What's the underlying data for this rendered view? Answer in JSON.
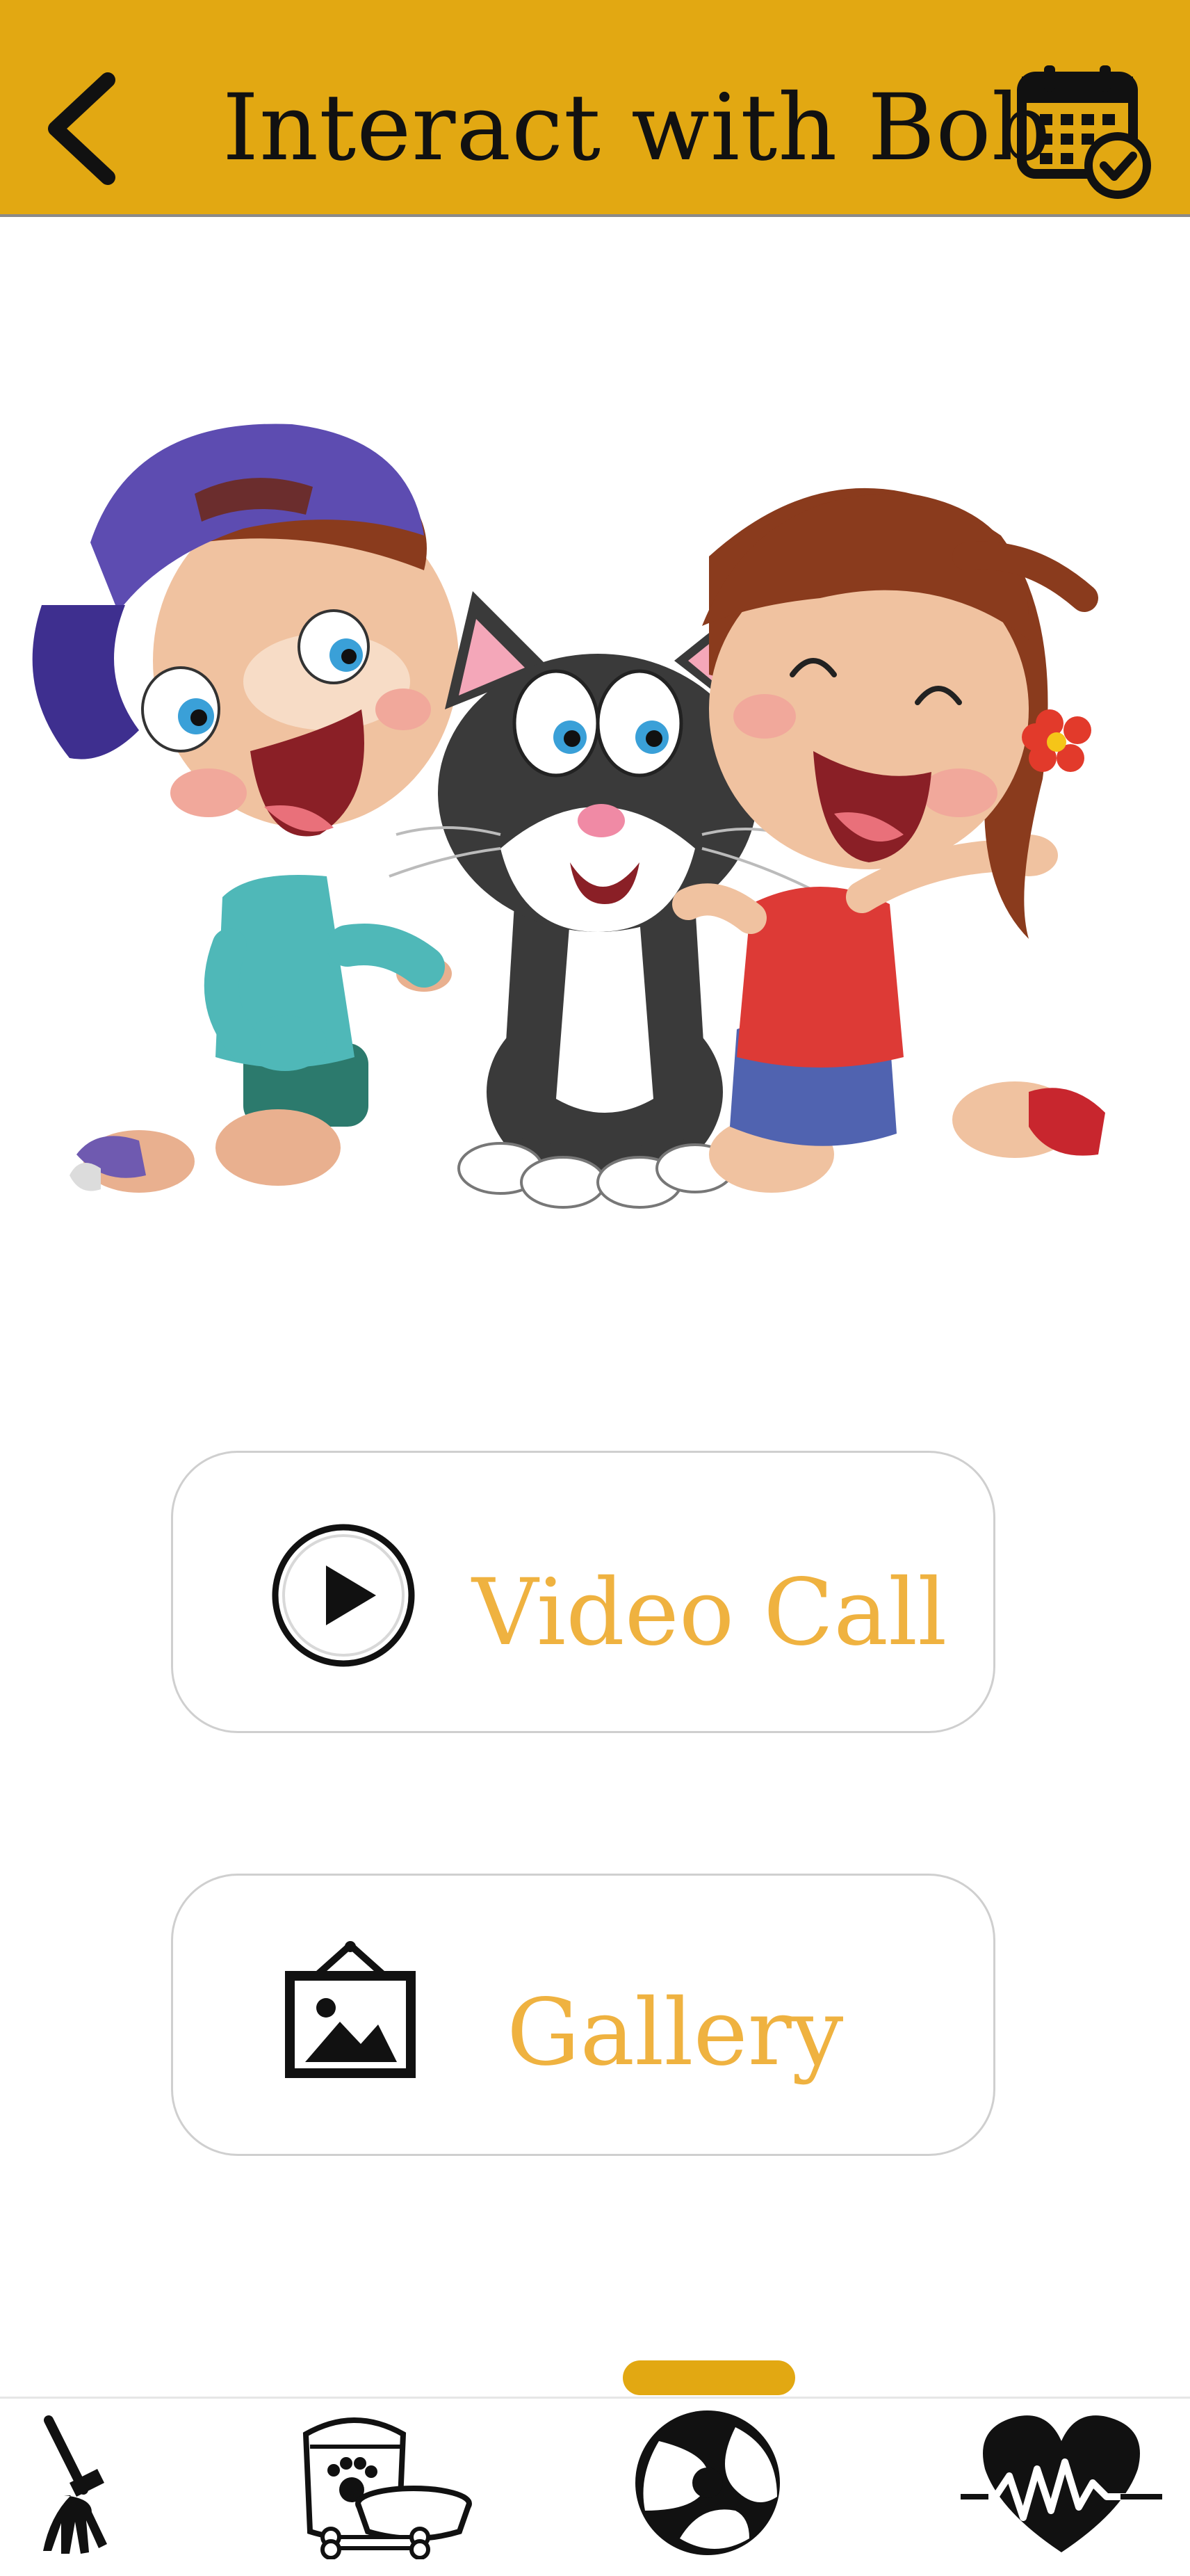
{
  "header": {
    "title": "Interact with Bob",
    "background_color": "#e2a812",
    "back_icon": "chevron-left-icon",
    "calendar_icon": "calendar-check-icon"
  },
  "hero": {
    "illustration": "kids-with-cat-illustration"
  },
  "actions": {
    "video_call_label": "Video Call",
    "video_call_icon": "play-circle-icon",
    "gallery_label": "Gallery",
    "gallery_icon": "framed-picture-icon",
    "label_color": "#efb240"
  },
  "bottom_nav": {
    "items": [
      {
        "icon": "broom-icon"
      },
      {
        "icon": "pet-food-icon"
      },
      {
        "icon": "ball-icon"
      },
      {
        "icon": "heartbeat-icon"
      }
    ],
    "active_index": 2,
    "indicator_color": "#e2a812"
  }
}
